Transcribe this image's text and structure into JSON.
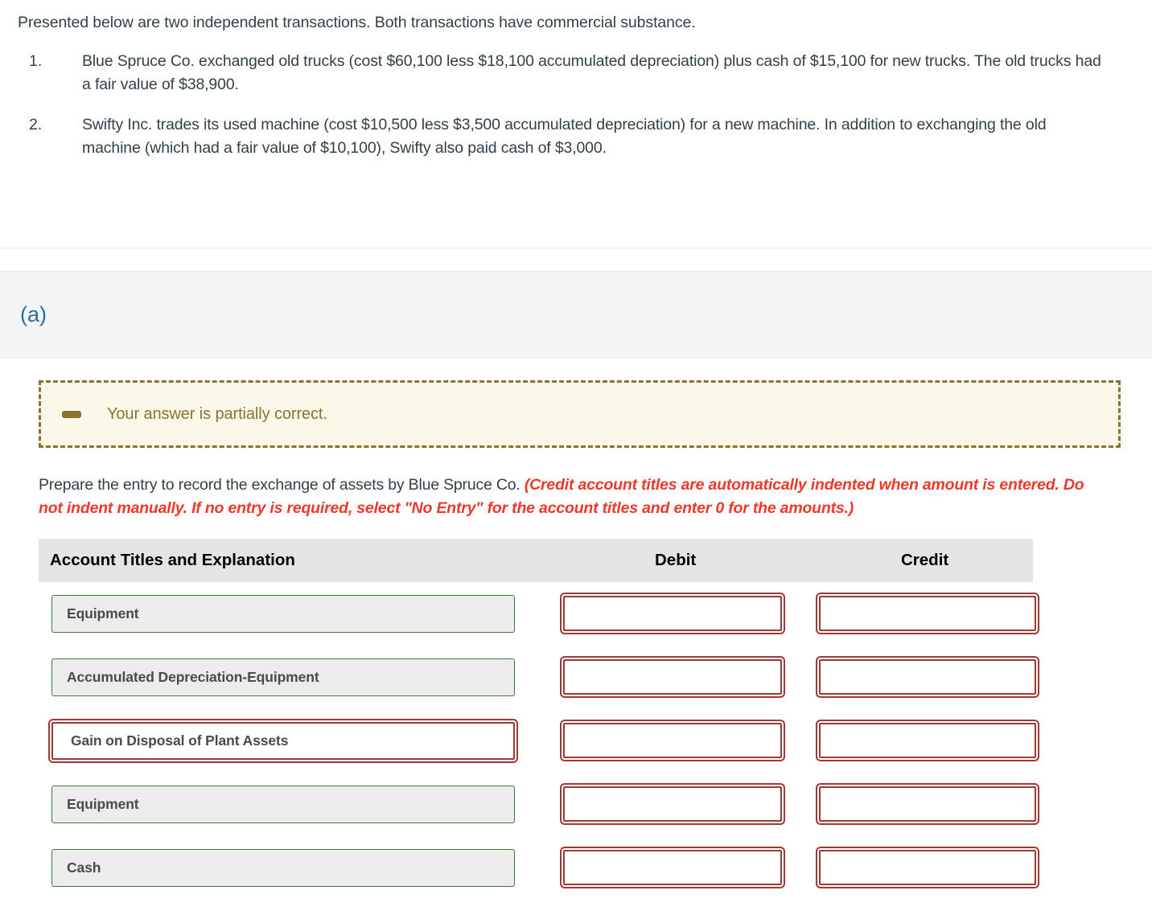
{
  "intro": {
    "lead": "Presented below are two independent transactions. Both transactions have commercial substance.",
    "items": [
      {
        "marker": "1.",
        "text": "Blue Spruce Co. exchanged old trucks (cost $60,100 less $18,100 accumulated depreciation) plus cash of $15,100 for new trucks. The old trucks had a fair value of $38,900."
      },
      {
        "marker": "2.",
        "text": "Swifty Inc. trades its used machine (cost $10,500 less $3,500 accumulated depreciation) for a new machine. In addition to exchanging the old machine (which had a fair value of $10,100), Swifty also paid cash of $3,000."
      }
    ]
  },
  "part": {
    "label": "(a)",
    "label_color": "#2b6ca3"
  },
  "alert": {
    "icon": "minus-icon",
    "message": "Your answer is partially correct.",
    "color": "#8a7232",
    "background": "#fbf8e9"
  },
  "instruction": {
    "plain": "Prepare the entry to record the exchange of assets by Blue Spruce Co.",
    "note": "(Credit account titles are automatically indented when amount is entered. Do not indent manually. If no entry is required, select \"No Entry\" for the account titles and enter 0 for the amounts.)",
    "note_color": "#ef3829"
  },
  "journal": {
    "headers": {
      "account": "Account Titles and Explanation",
      "debit": "Debit",
      "credit": "Credit"
    },
    "header_background": "#e4e4e4",
    "status_colors": {
      "correct": "#40773a",
      "incorrect": "#9c3a38"
    },
    "rows": [
      {
        "account": "Equipment",
        "account_status": "correct",
        "debit": "",
        "credit": "",
        "debit_status": "incorrect",
        "credit_status": "incorrect"
      },
      {
        "account": "Accumulated Depreciation-Equipment",
        "account_status": "correct",
        "debit": "",
        "credit": "",
        "debit_status": "incorrect",
        "credit_status": "incorrect"
      },
      {
        "account": "Gain on Disposal of Plant Assets",
        "account_status": "incorrect",
        "debit": "",
        "credit": "",
        "debit_status": "incorrect",
        "credit_status": "incorrect"
      },
      {
        "account": "Equipment",
        "account_status": "correct",
        "debit": "",
        "credit": "",
        "debit_status": "incorrect",
        "credit_status": "incorrect"
      },
      {
        "account": "Cash",
        "account_status": "correct",
        "debit": "",
        "credit": "",
        "debit_status": "incorrect",
        "credit_status": "incorrect"
      }
    ]
  }
}
